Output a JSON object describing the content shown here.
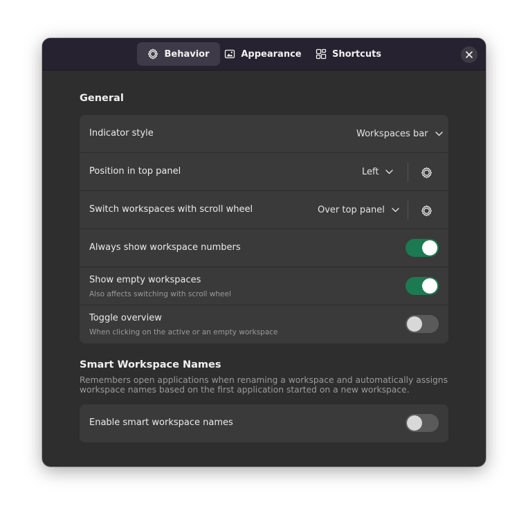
{
  "tabs": [
    {
      "label": "Behavior",
      "icon": "gear-icon",
      "active": true
    },
    {
      "label": "Appearance",
      "icon": "image-icon",
      "active": false
    },
    {
      "label": "Shortcuts",
      "icon": "shortcuts-icon",
      "active": false
    }
  ],
  "close_icon": "close-icon",
  "general": {
    "title": "General",
    "rows": [
      {
        "title": "Indicator style",
        "control": "dropdown",
        "value": "Workspaces bar"
      },
      {
        "title": "Position in top panel",
        "control": "dropdown-with-settings",
        "value": "Left"
      },
      {
        "title": "Switch workspaces with scroll wheel",
        "control": "dropdown-with-settings",
        "value": "Over top panel"
      },
      {
        "title": "Always show workspace numbers",
        "control": "toggle",
        "on": true
      },
      {
        "title": "Show empty workspaces",
        "subtitle": "Also affects switching with scroll wheel",
        "control": "toggle",
        "on": true
      },
      {
        "title": "Toggle overview",
        "subtitle": "When clicking on the active or an empty workspace",
        "control": "toggle",
        "on": false
      }
    ]
  },
  "smart": {
    "title": "Smart Workspace Names",
    "description": "Remembers open applications when renaming a workspace and automatically assigns workspace names based on the first application started on a new workspace.",
    "rows": [
      {
        "title": "Enable smart workspace names",
        "control": "toggle",
        "on": false
      }
    ]
  },
  "colors": {
    "toggle_on": "#1b7a52",
    "toggle_off": "#5a5a5a",
    "header_bg": "#26222f",
    "window_bg": "#2e2e2e",
    "card_bg": "#3a3a3a"
  }
}
